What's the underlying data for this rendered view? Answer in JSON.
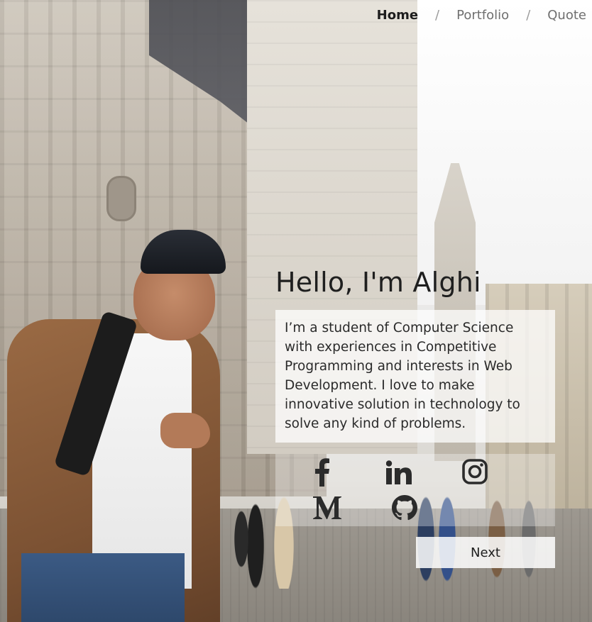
{
  "nav": {
    "items": [
      {
        "label": "Home",
        "active": true
      },
      {
        "label": "Portfolio",
        "active": false
      },
      {
        "label": "Quote",
        "active": false
      }
    ],
    "separator": "/"
  },
  "hero": {
    "greeting": "Hello, I'm Alghi",
    "bio": "I’m a student of Computer Science with experiences in Competitive Programming and interests in Web Development. I love to make innovative solution in technology to solve any kind of problems."
  },
  "socials": [
    {
      "icon": "facebook-icon"
    },
    {
      "icon": "linkedin-icon"
    },
    {
      "icon": "instagram-icon"
    },
    {
      "icon": "medium-icon"
    },
    {
      "icon": "github-icon"
    }
  ],
  "next_button": {
    "label": "Next"
  },
  "colors": {
    "text_dark": "#1d1d1d",
    "nav_inactive": "#6f6f6f",
    "panel_bg": "rgba(255,255,255,0.74)"
  }
}
